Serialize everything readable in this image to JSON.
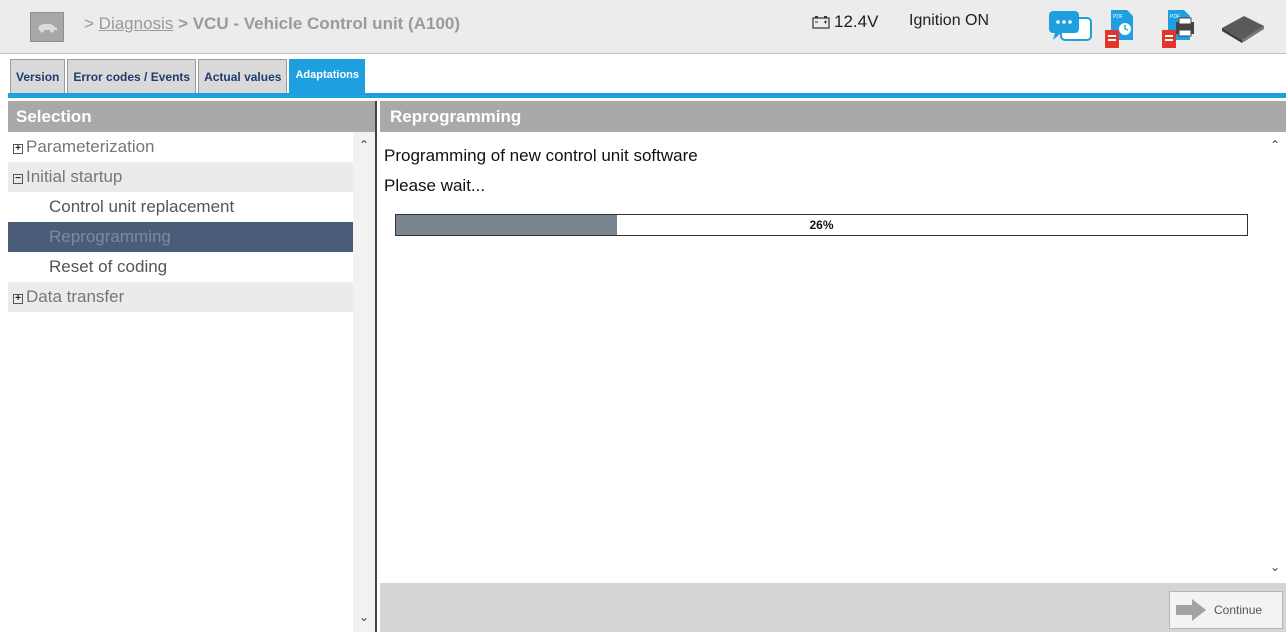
{
  "header": {
    "breadcrumb_sep1": ">",
    "breadcrumb_link": "Diagnosis",
    "breadcrumb_current": "> VCU - Vehicle Control unit (A100)",
    "voltage": "12.4V",
    "ignition": "Ignition ON"
  },
  "tabs": [
    {
      "label": "Version"
    },
    {
      "label": "Error codes / Events"
    },
    {
      "label": "Actual values"
    },
    {
      "label": "Adaptations"
    }
  ],
  "left_panel": {
    "title": "Selection",
    "items": [
      {
        "label": "Parameterization",
        "toggle": "+"
      },
      {
        "label": "Initial startup",
        "toggle": "−"
      },
      {
        "label": "Control unit replacement"
      },
      {
        "label": "Reprogramming"
      },
      {
        "label": "Reset of coding"
      },
      {
        "label": "Data transfer",
        "toggle": "+"
      }
    ]
  },
  "right_panel": {
    "title": "Reprogramming",
    "line1": "Programming of new control unit software",
    "line2": "Please wait...",
    "progress_text": "26%",
    "progress_fraction": 0.26,
    "continue_label": "Continue"
  },
  "colors": {
    "accent": "#1ea0e0",
    "selected_row": "#4a5c78",
    "progress_fill": "#7a8591"
  }
}
